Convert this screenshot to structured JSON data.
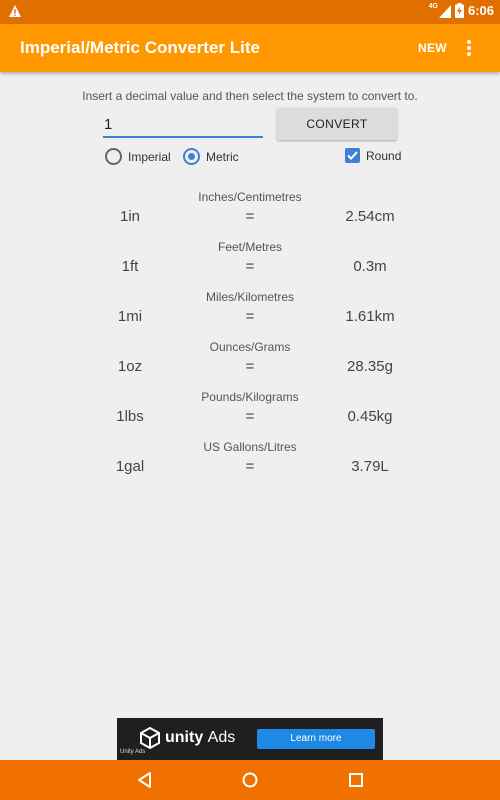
{
  "status_bar": {
    "network": "4G",
    "time": "6:06"
  },
  "app_bar": {
    "title": "Imperial/Metric Converter Lite",
    "new_label": "NEW"
  },
  "instruction": "Insert a decimal value and then select the system to convert to.",
  "input": {
    "value": "1"
  },
  "convert_label": "CONVERT",
  "systems": {
    "imperial_label": "Imperial",
    "metric_label": "Metric",
    "selected": "Metric"
  },
  "round": {
    "label": "Round",
    "checked": true
  },
  "conversions": [
    {
      "heading": "Inches/Centimetres",
      "from": "1in",
      "equals": "=",
      "to": "2.54cm"
    },
    {
      "heading": "Feet/Metres",
      "from": "1ft",
      "equals": "=",
      "to": "0.3m"
    },
    {
      "heading": "Miles/Kilometres",
      "from": "1mi",
      "equals": "=",
      "to": "1.61km"
    },
    {
      "heading": "Ounces/Grams",
      "from": "1oz",
      "equals": "=",
      "to": "28.35g"
    },
    {
      "heading": "Pounds/Kilograms",
      "from": "1lbs",
      "equals": "=",
      "to": "0.45kg"
    },
    {
      "heading": "US Gallons/Litres",
      "from": "1gal",
      "equals": "=",
      "to": "3.79L"
    }
  ],
  "ad": {
    "brand_main": "unity",
    "brand_suffix": "Ads",
    "mini_text": "Unity Ads",
    "cta": "Learn more"
  },
  "colors": {
    "status_bar": "#e06f00",
    "app_bar": "#ff9800",
    "accent": "#3f7fd6",
    "nav_bar": "#f07000"
  },
  "icons": {
    "status_left": "warning-icon",
    "signal": "signal-icon",
    "battery": "battery-charging-icon",
    "overflow": "more-vert-icon",
    "nav_back": "back-triangle-icon",
    "nav_home": "home-circle-icon",
    "nav_recents": "recents-square-icon"
  }
}
